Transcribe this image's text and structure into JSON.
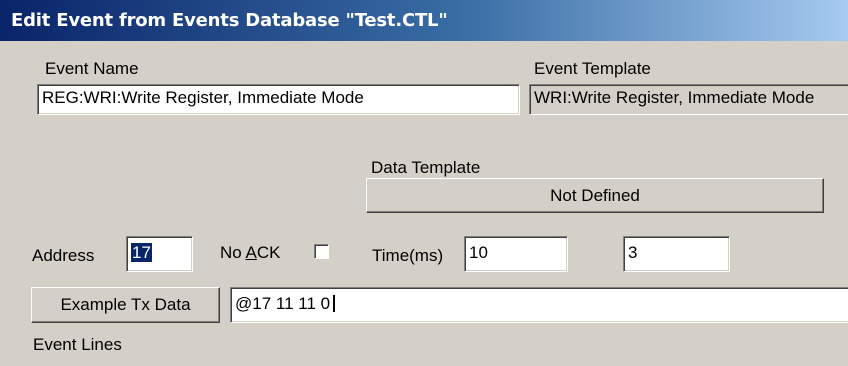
{
  "window": {
    "title": "Edit Event from Events Database \"Test.CTL\""
  },
  "event_name": {
    "label": "Event Name",
    "value": "REG:WRI:Write Register, Immediate Mode"
  },
  "event_template": {
    "label": "Event Template",
    "value": "WRI:Write Register, Immediate Mode"
  },
  "data_template": {
    "label": "Data Template",
    "button_label": "Not Defined"
  },
  "address": {
    "label": "Address",
    "value": "17"
  },
  "no_ack": {
    "label_prefix": "No ",
    "label_accel": "A",
    "label_suffix": "CK",
    "checked": false
  },
  "time": {
    "label": "Time(ms)",
    "value": "10",
    "second_value": "3"
  },
  "example_tx": {
    "button_label": "Example Tx Data",
    "value": "@17 11 11 0"
  },
  "event_lines": {
    "label": "Event Lines"
  }
}
